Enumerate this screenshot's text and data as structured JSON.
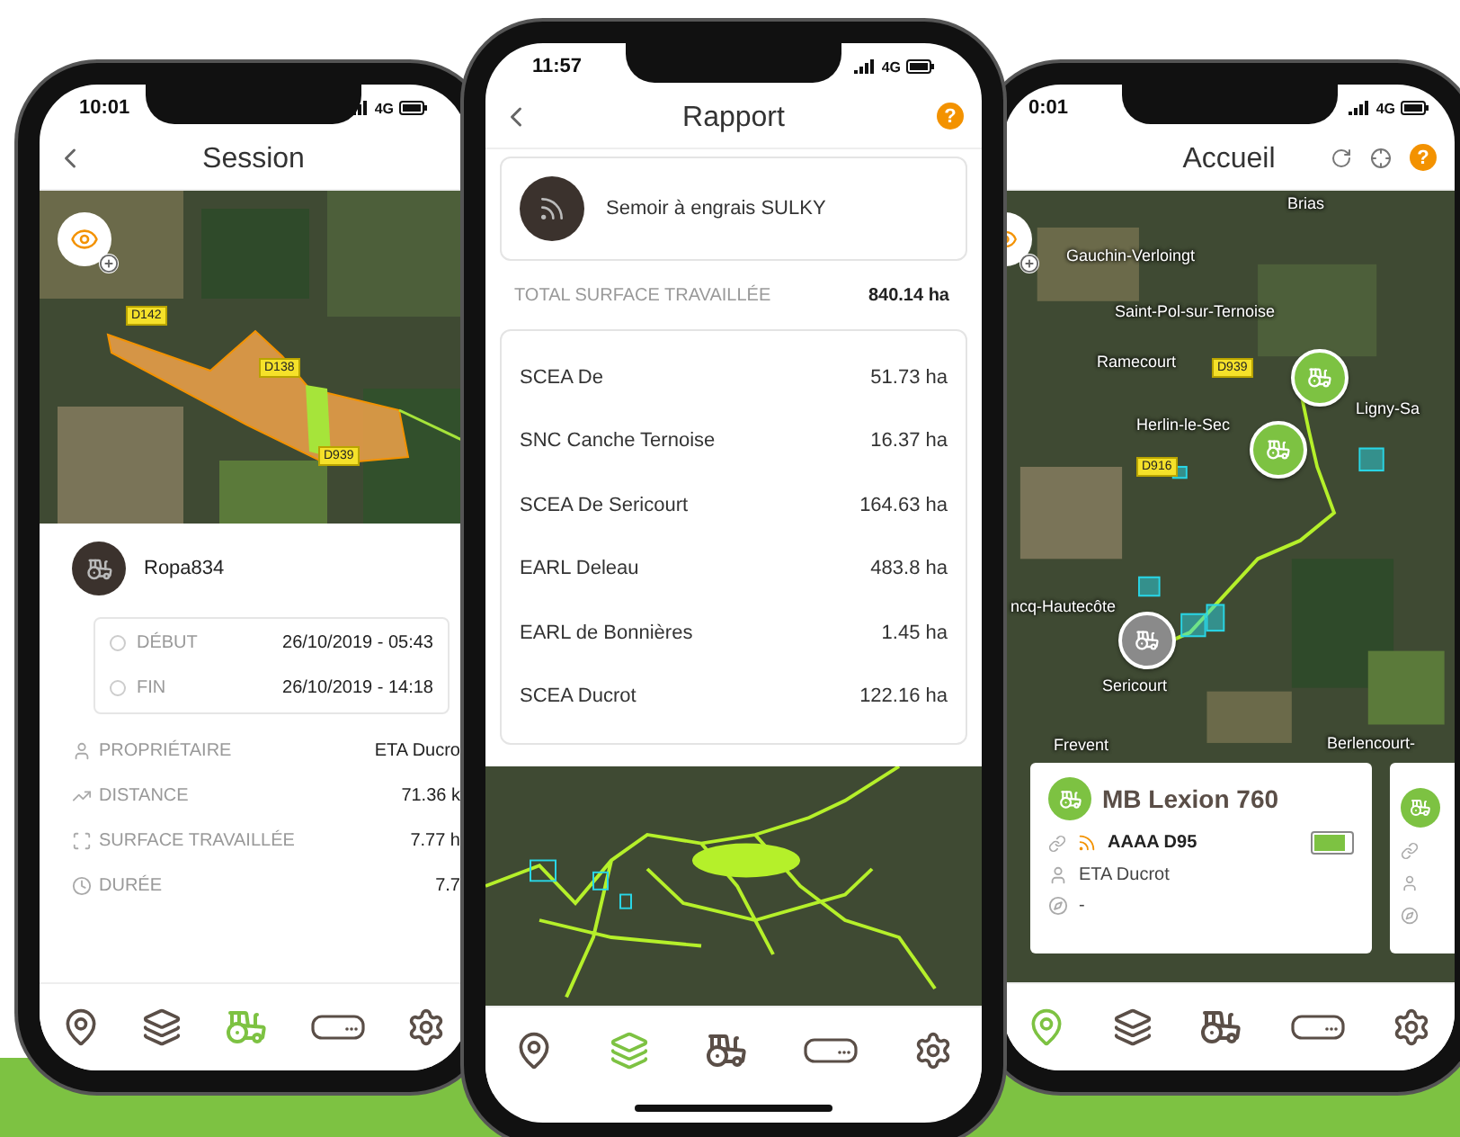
{
  "session_phone": {
    "status": {
      "time": "10:01",
      "network": "4G"
    },
    "title": "Session",
    "map_labels": [
      "D142",
      "D138",
      "D939"
    ],
    "machine": "Ropa834",
    "period": [
      {
        "label": "DÉBUT",
        "value": "26/10/2019 - 05:43"
      },
      {
        "label": "FIN",
        "value": "26/10/2019 - 14:18"
      }
    ],
    "stats": [
      {
        "kind": "owner",
        "label": "PROPRIÉTAIRE",
        "value": "ETA Ducro"
      },
      {
        "kind": "distance",
        "label": "DISTANCE",
        "value": "71.36 k"
      },
      {
        "kind": "surface",
        "label": "SURFACE TRAVAILLÉE",
        "value": "7.77 h"
      },
      {
        "kind": "duration",
        "label": "DURÉE",
        "value": "7.7"
      }
    ],
    "nav": [
      {
        "kind": "pins",
        "selected": false
      },
      {
        "kind": "layers",
        "selected": false
      },
      {
        "kind": "tractor",
        "selected": true
      },
      {
        "kind": "device",
        "selected": false
      },
      {
        "kind": "settings",
        "selected": false
      }
    ]
  },
  "report_phone": {
    "status": {
      "time": "11:57",
      "network": "4G"
    },
    "title": "Rapport",
    "help": "?",
    "implement": "Semoir à engrais SULKY",
    "total": {
      "label": "TOTAL SURFACE TRAVAILLÉE",
      "value": "840.14 ha"
    },
    "rows": [
      {
        "name": "SCEA De",
        "value": "51.73 ha"
      },
      {
        "name": "SNC Canche Ternoise",
        "value": "16.37 ha"
      },
      {
        "name": "SCEA De Sericourt",
        "value": "164.63 ha"
      },
      {
        "name": "EARL Deleau",
        "value": "483.8 ha"
      },
      {
        "name": "EARL de Bonnières",
        "value": "1.45 ha"
      },
      {
        "name": "SCEA Ducrot",
        "value": "122.16 ha"
      }
    ],
    "nav": [
      {
        "kind": "pins",
        "selected": false
      },
      {
        "kind": "layers",
        "selected": true
      },
      {
        "kind": "tractor",
        "selected": false
      },
      {
        "kind": "device",
        "selected": false
      },
      {
        "kind": "settings",
        "selected": false
      }
    ]
  },
  "home_phone": {
    "status": {
      "time": "0:01",
      "network": "4G"
    },
    "title": "Accueil",
    "help": "?",
    "map_labels": [
      "Brias",
      "Gauchin-Verloingt",
      "Saint-Pol-sur-Ternoise",
      "Ramecourt",
      "D939",
      "Herlin-le-Sec",
      "D916",
      "Ligny-Sa",
      "ncq-Hautecôte",
      "Sericourt",
      "Frevent",
      "Berlencourt-"
    ],
    "pins": [
      {
        "active": true
      },
      {
        "active": true
      },
      {
        "active": false
      }
    ],
    "card": {
      "name": "MB Lexion 760",
      "plate": "AAAA D95",
      "owner": "ETA Ducrot",
      "heading": "-",
      "battery": {
        "level": 0.85
      }
    },
    "nav": [
      {
        "kind": "pins",
        "selected": true
      },
      {
        "kind": "layers",
        "selected": false
      },
      {
        "kind": "tractor",
        "selected": false
      },
      {
        "kind": "device",
        "selected": false
      },
      {
        "kind": "settings",
        "selected": false
      }
    ]
  }
}
